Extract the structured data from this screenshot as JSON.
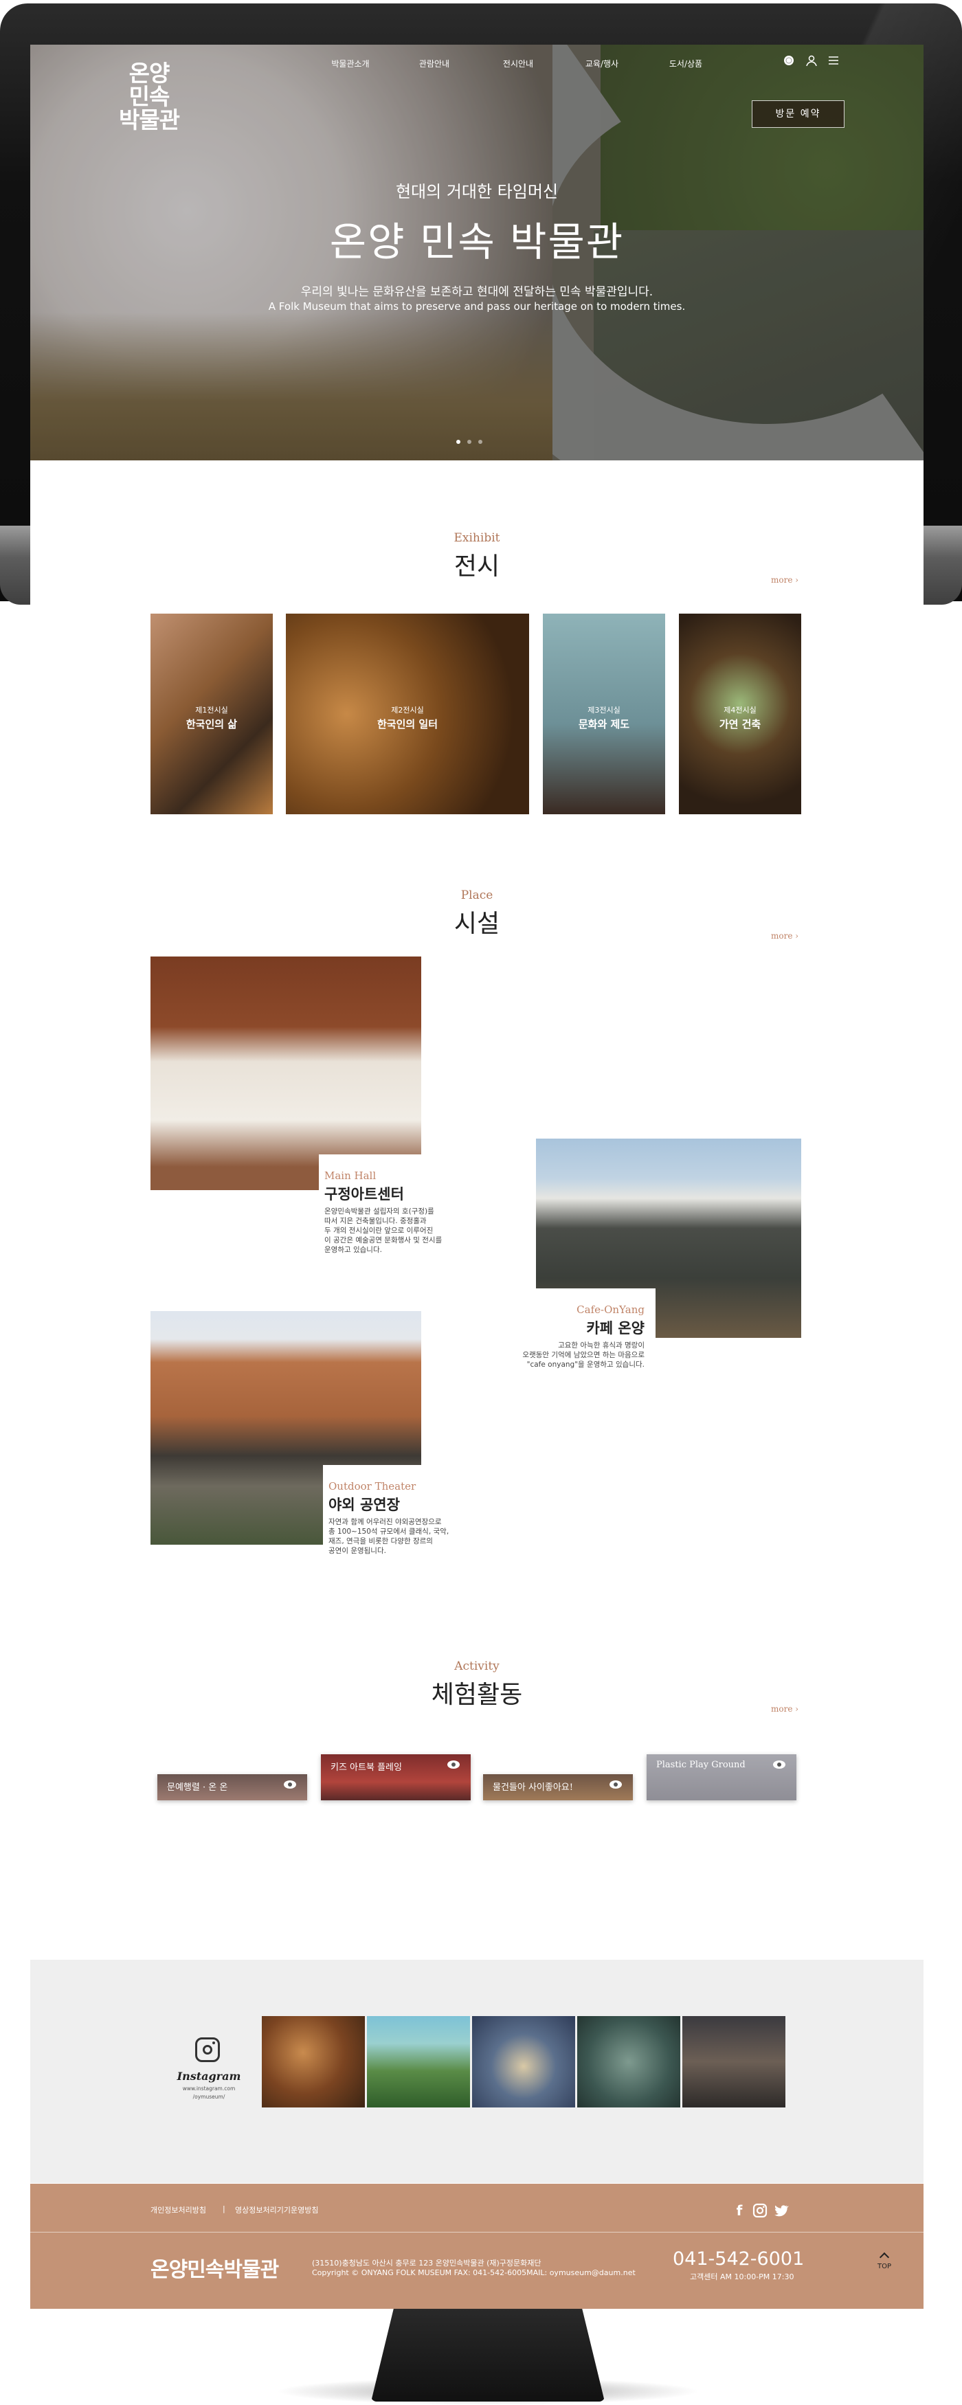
{
  "colors": {
    "accent": "#c08468",
    "footer": "#c49376",
    "insta_bg": "#efefef"
  },
  "header": {
    "logo": "온양\n민속\n박물관",
    "nav": [
      "박물관소개",
      "관람안내",
      "전시안내",
      "교육/행사",
      "도서/상품"
    ],
    "icons": [
      "globe-icon",
      "user-icon",
      "menu-icon"
    ],
    "visit_button": "방문 예약"
  },
  "hero": {
    "subtitle": "현대의 거대한 타임머신",
    "title": "온양 민속 박물관",
    "desc_ko": "우리의 빛나는 문화유산을 보존하고 현대에 전달하는 민속 박물관입니다.",
    "desc_en": "A Folk Museum that aims to preserve and pass our heritage on to modern times."
  },
  "exhibit": {
    "en": "Exihibit",
    "ko": "전시",
    "more": "more",
    "items": [
      {
        "label1": "제1전시실",
        "label2": "한국인의 삶"
      },
      {
        "label1": "제2전시실",
        "label2": "한국인의 일터"
      },
      {
        "label1": "제3전시실",
        "label2": "문화와 제도"
      },
      {
        "label1": "제4전시실",
        "label2": "가연 건축"
      }
    ]
  },
  "place": {
    "en": "Place",
    "ko": "시설",
    "more": "more",
    "items": [
      {
        "en": "Main Hall",
        "ko": "구정아트센터",
        "desc": "온양민속박물관 설립자의 호(구정)를\n따서 지은 건축물입니다. 중정홀과\n두 개의 전시실이란 앞으로 이루어진\n이 공간은 예술공연 문화행사 및 전시를\n운영하고 있습니다."
      },
      {
        "en": "Cafe-OnYang",
        "ko": "카페 온양",
        "desc": "고요한 아늑한 휴식과 명랑이\n오랫동안 기억에 남았으면 하는 마음으로\n\"cafe onyang\"을 운영하고 있습니다."
      },
      {
        "en": "Outdoor Theater",
        "ko": "야외 공연장",
        "desc": "자연과 함께 어우러진 야외공연장으로\n총 100~150석 규모에서 클래식, 국악,\n재즈, 연극을 비롯한 다양한 장르의\n공연이 운영됩니다."
      }
    ]
  },
  "activity": {
    "en": "Activity",
    "ko": "체험활동",
    "more": "more",
    "items": [
      {
        "label": "문예행렬 · 온 온"
      },
      {
        "label": "키즈 아트북 플레잉"
      },
      {
        "label": "물건들아 사이좋아요!"
      },
      {
        "label": "Plastic Play Ground"
      }
    ]
  },
  "instagram": {
    "title": "Instagram",
    "url": "www.instagram.com",
    "id": "/oymuseum/"
  },
  "footer": {
    "link1": "개인정보처리방침",
    "sep": "|",
    "link2": "영상정보처리기기운영방침",
    "sns": [
      "facebook-icon",
      "instagram-icon",
      "twitter-icon"
    ],
    "logo": "온양민속박물관",
    "address": "(31510)충청남도 아산시 충무로 123 온양민속박물관 (재)구정문화재단",
    "copyright": "Copyright © ONYANG FOLK MUSEUM     FAX: 041-542-6005MAIL: oymuseum@daum.net",
    "tel": "041-542-6001",
    "hours": "고객센터 AM 10:00-PM 17:30",
    "top": "TOP"
  }
}
